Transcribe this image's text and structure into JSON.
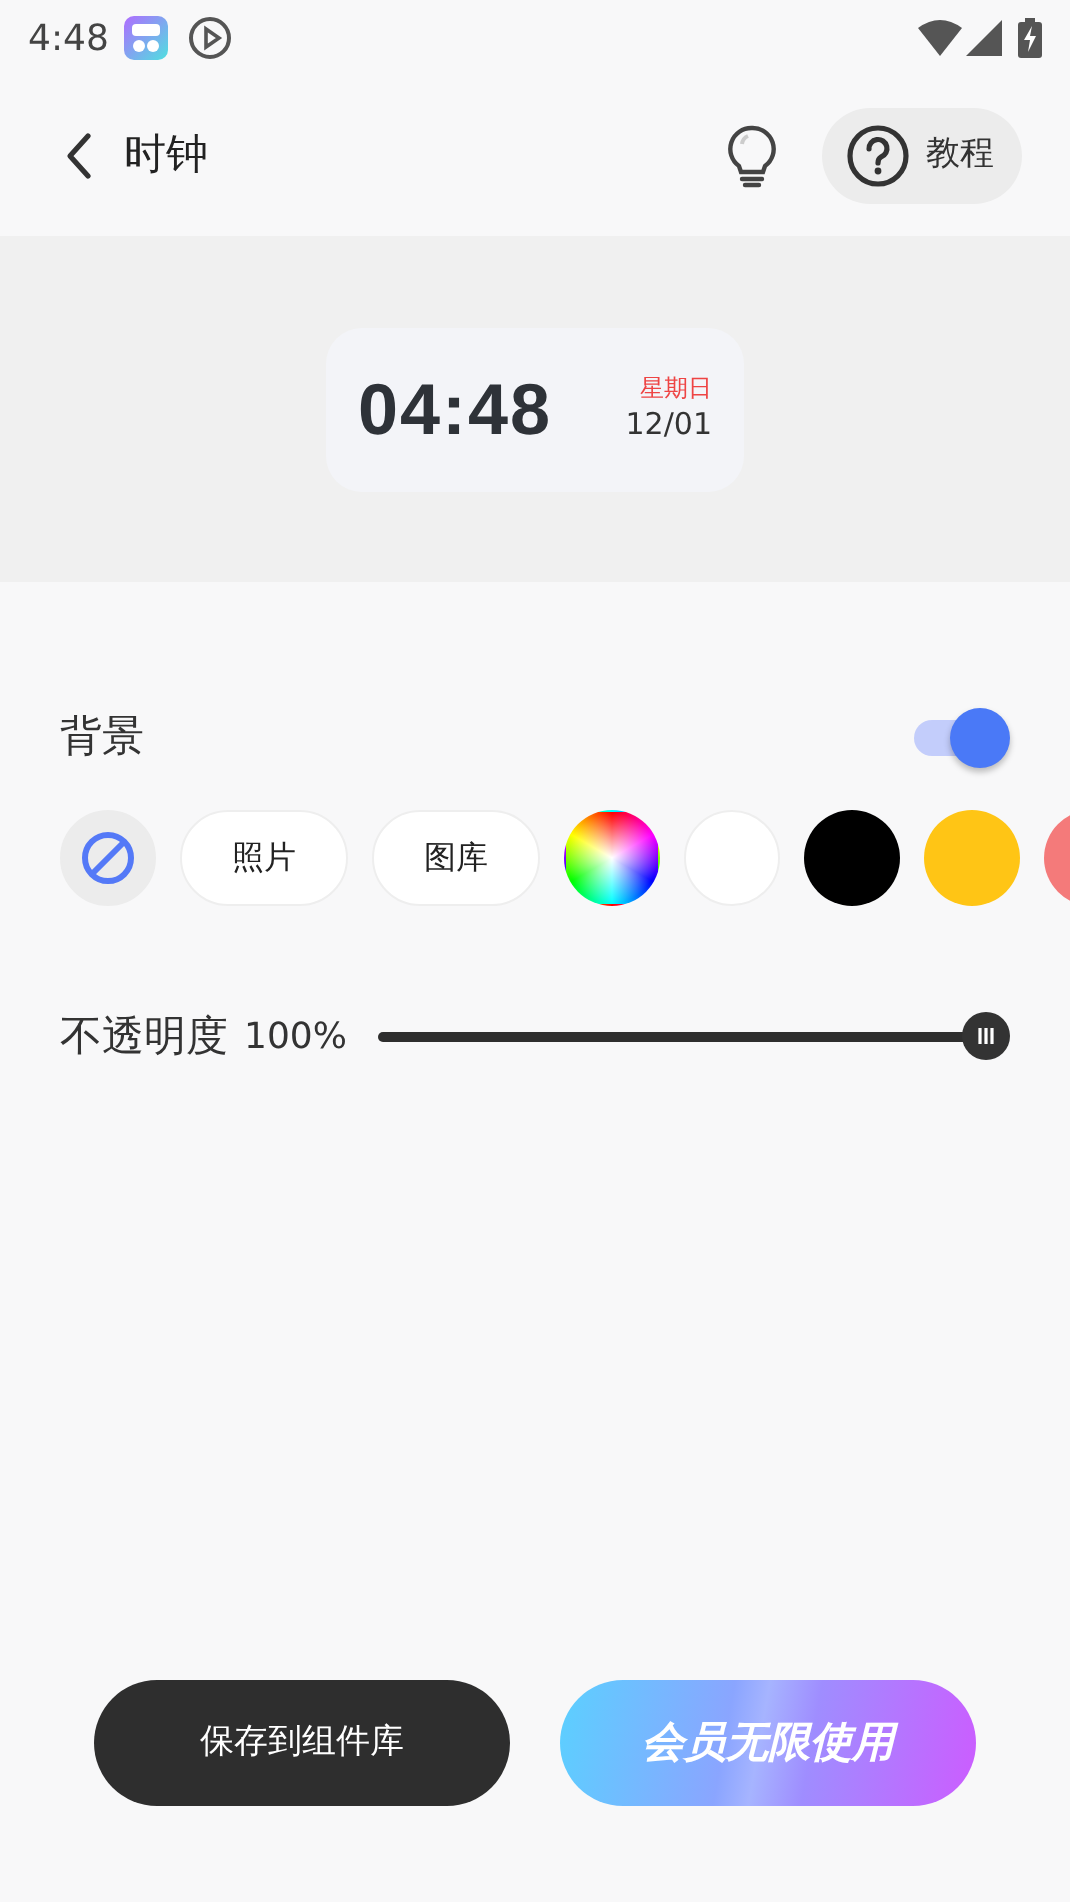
{
  "status_bar": {
    "time": "4:48"
  },
  "header": {
    "title": "时钟",
    "tutorial_button": "教程"
  },
  "preview": {
    "time": "04:48",
    "weekday": "星期日",
    "date": "12/01"
  },
  "background": {
    "label": "背景",
    "on": true,
    "options": [
      {
        "kind": "none",
        "selected": true
      },
      {
        "kind": "text",
        "label": "照片",
        "selected": false
      },
      {
        "kind": "text",
        "label": "图库",
        "selected": false
      },
      {
        "kind": "wheel",
        "selected": false
      },
      {
        "kind": "swatch",
        "color": "#ffffff",
        "selected": false
      },
      {
        "kind": "swatch",
        "color": "#000000",
        "selected": false
      },
      {
        "kind": "swatch",
        "color": "#ffc515",
        "selected": false
      },
      {
        "kind": "swatch",
        "color": "#f47a7a",
        "selected": false
      }
    ]
  },
  "opacity": {
    "label": "不透明度",
    "reading": "100%",
    "level": 1
  },
  "buttons": [
    {
      "kind": "dark",
      "label": "保存到组件库"
    },
    {
      "kind": "gradient",
      "label": "会员无限使用"
    }
  ]
}
